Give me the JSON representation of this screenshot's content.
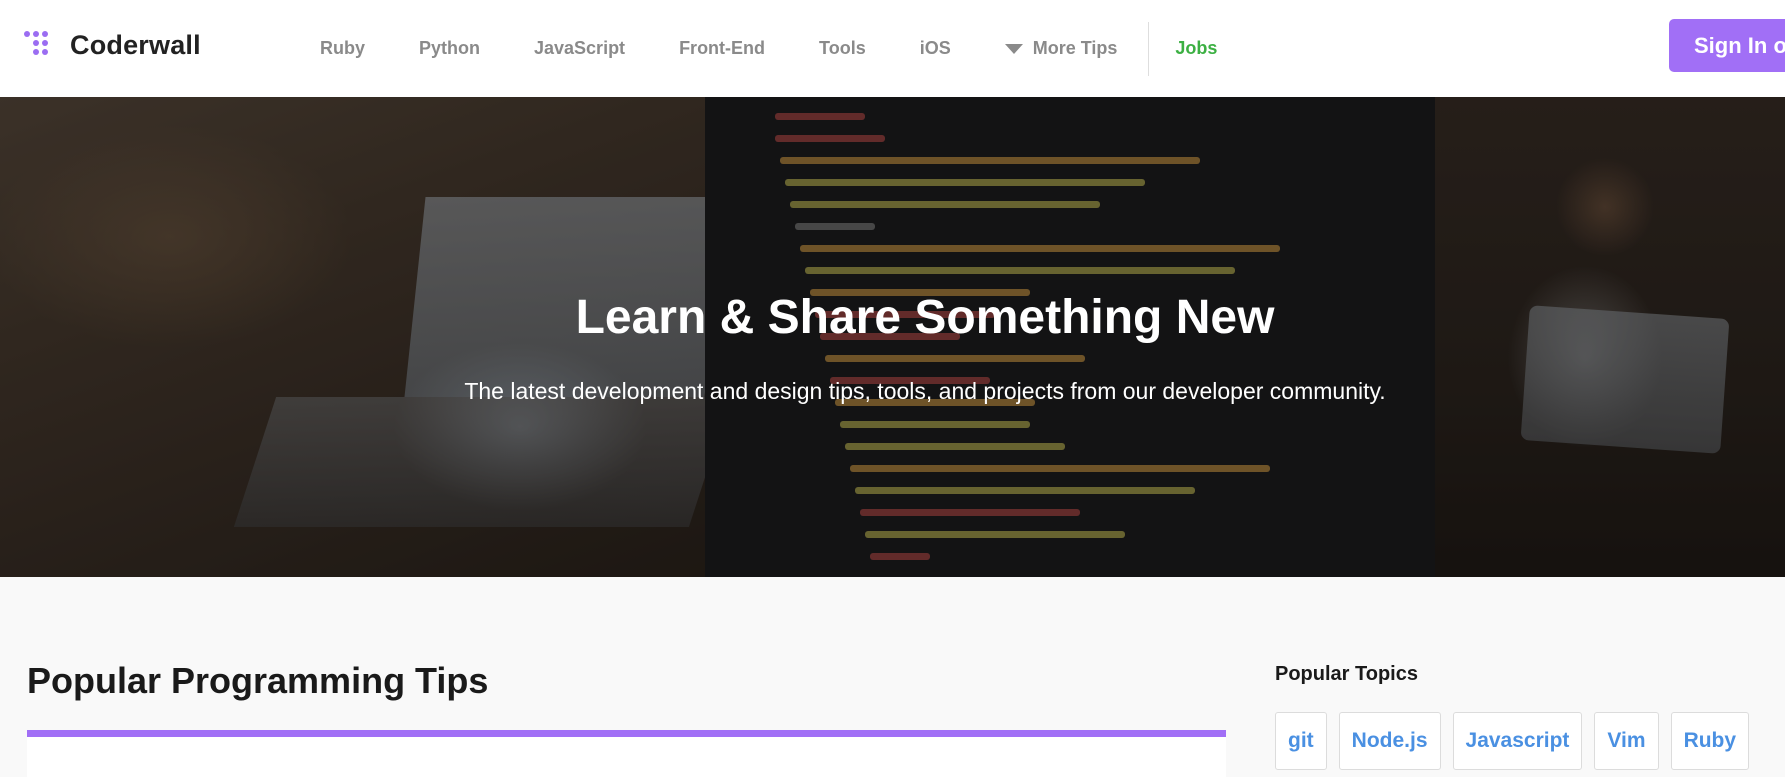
{
  "header": {
    "logo_text": "Coderwall",
    "nav": [
      {
        "label": "Ruby"
      },
      {
        "label": "Python"
      },
      {
        "label": "JavaScript"
      },
      {
        "label": "Front-End"
      },
      {
        "label": "Tools"
      },
      {
        "label": "iOS"
      },
      {
        "label": "More Tips",
        "icon": "caret-down-icon"
      },
      {
        "label": "Jobs"
      }
    ],
    "signin_label": "Sign In or Up"
  },
  "hero": {
    "title": "Learn & Share Something New",
    "subtitle": "The latest development and design tips, tools, and projects from our developer community."
  },
  "main": {
    "section_title": "Popular Programming Tips"
  },
  "sidebar": {
    "title": "Popular Topics",
    "topics": [
      "git",
      "Node.js",
      "Javascript",
      "Vim",
      "Ruby"
    ]
  },
  "colors": {
    "accent": "#a16ff6",
    "jobs": "#3cb043",
    "link": "#4a90e2",
    "nav_text": "#8a8a8a"
  }
}
